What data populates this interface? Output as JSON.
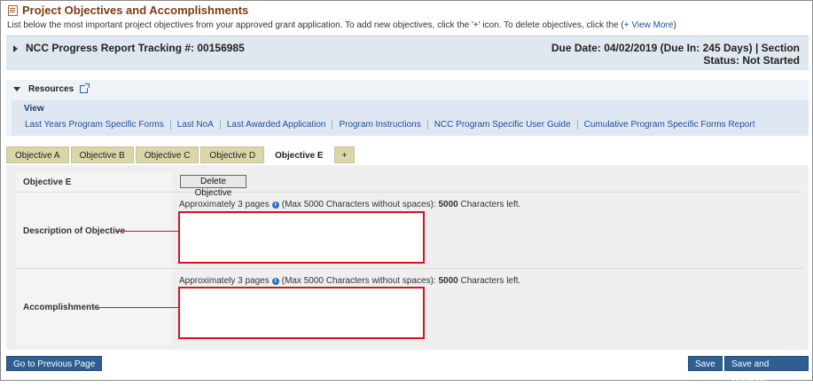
{
  "page": {
    "title": "Project Objectives and Accomplishments",
    "intro": "List below the most important project objectives from your approved grant application. To add new objectives, click the '+' icon. To delete objectives, click the (",
    "view_more": "+ View More",
    "intro_end": ")"
  },
  "tracking": {
    "label": "NCC Progress Report Tracking #: 00156985",
    "due_line": "Due Date: 04/02/2019 (Due In: 245 Days) | Section",
    "status_line": "Status: Not Started"
  },
  "resources": {
    "header": "Resources",
    "view_label": "View",
    "links": [
      "Last Years Program Specific Forms",
      "Last NoA",
      "Last Awarded Application",
      "Program Instructions",
      "NCC Program Specific User Guide",
      "Cumulative Program Specific Forms Report"
    ]
  },
  "tabs": [
    "Objective A",
    "Objective B",
    "Objective C",
    "Objective D",
    "Objective E",
    "+"
  ],
  "active_tab_index": 4,
  "objective": {
    "name_label": "Objective E",
    "delete_button": "Delete Objective",
    "description": {
      "label": "Description of Objective",
      "hint_prefix": "Approximately 3 pages",
      "hint_middle": "(Max 5000 Characters without spaces):",
      "chars_left": "5000",
      "hint_suffix": "Characters left.",
      "value": ""
    },
    "accomplishments": {
      "label": "Accomplishments",
      "hint_prefix": "Approximately 3 pages",
      "hint_middle": "(Max 5000 Characters without spaces):",
      "chars_left": "5000",
      "hint_suffix": "Characters left.",
      "value": ""
    }
  },
  "footer": {
    "previous": "Go to Previous Page",
    "save": "Save",
    "save_continue": "Save and Continue"
  },
  "colors": {
    "title": "#7a3a14",
    "link": "#1a4f9c",
    "button": "#2f5f92",
    "highlight": "#d4141f",
    "tab": "#d9d6a8"
  }
}
